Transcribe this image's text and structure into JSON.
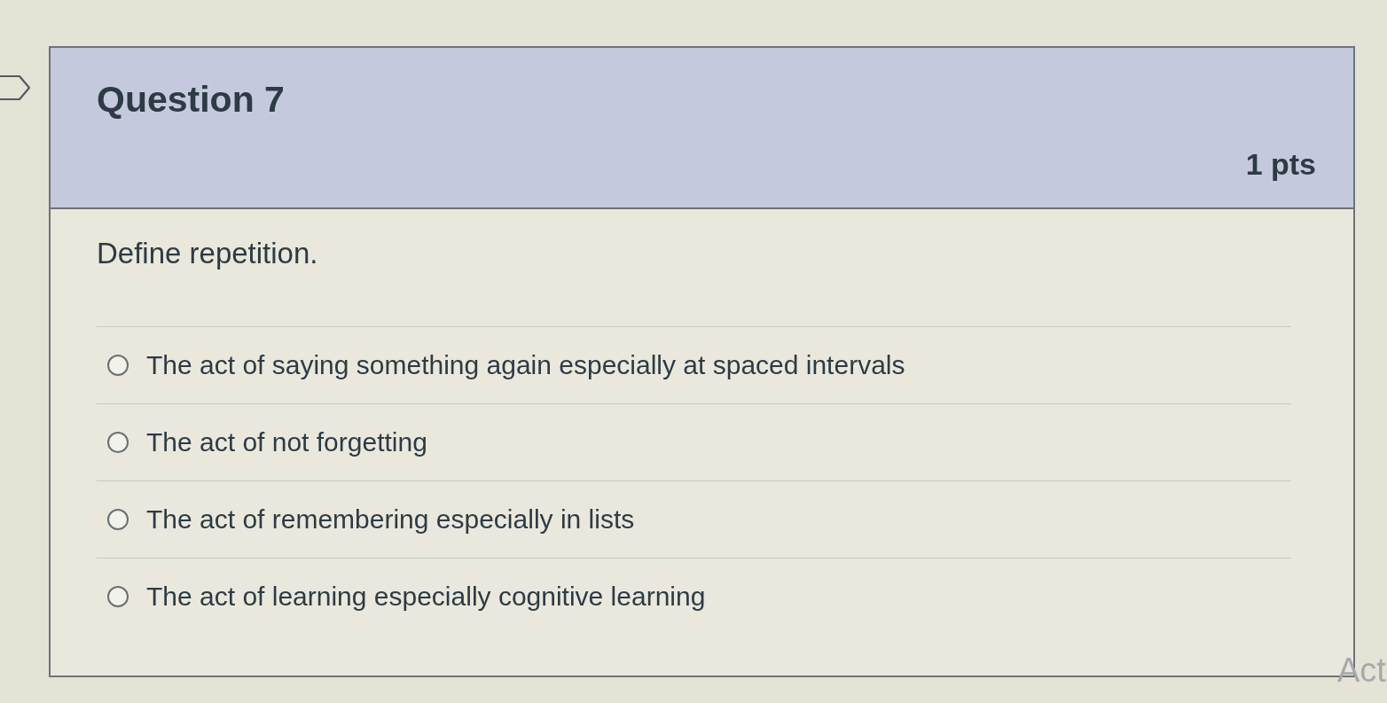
{
  "question": {
    "title": "Question 7",
    "points": "1 pts",
    "prompt": "Define repetition.",
    "answers": [
      {
        "text": "The act of saying something again especially at spaced intervals",
        "selected": false
      },
      {
        "text": "The act of not forgetting",
        "selected": false
      },
      {
        "text": "The act of remembering especially in lists",
        "selected": false
      },
      {
        "text": "The act of learning especially cognitive learning",
        "selected": false
      }
    ]
  },
  "overlay_text": "Act"
}
